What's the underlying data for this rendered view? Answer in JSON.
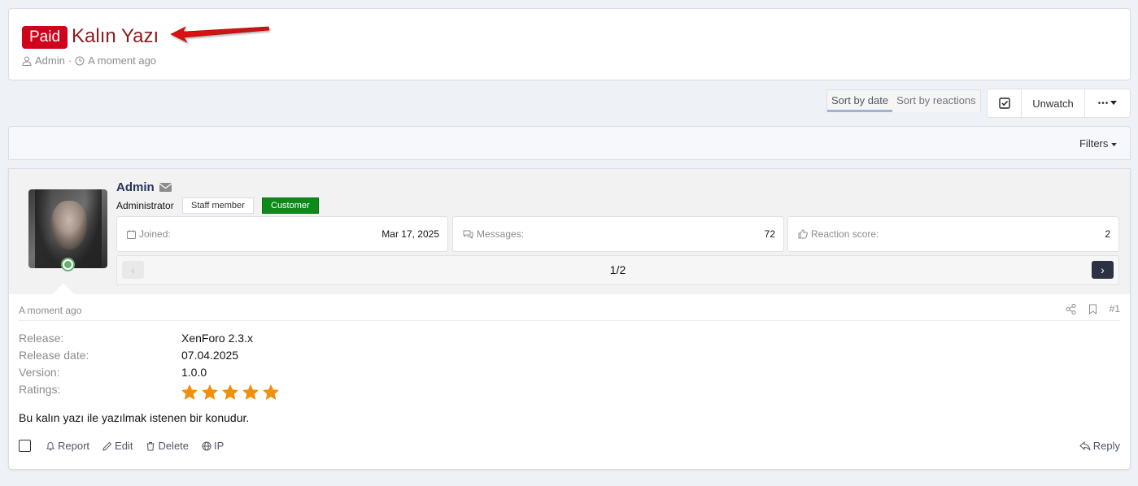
{
  "thread": {
    "badge": "Paid",
    "title": "Kalın Yazı",
    "author": "Admin",
    "time": "A moment ago",
    "meta_separator": "·"
  },
  "sort": {
    "options": [
      "Sort by date",
      "Sort by reactions"
    ],
    "active": "Sort by date"
  },
  "actions": {
    "unwatch": "Unwatch",
    "more": "•••"
  },
  "filters": {
    "label": "Filters"
  },
  "post": {
    "username": "Admin",
    "user_title": "Administrator",
    "badges": {
      "staff": "Staff member",
      "customer": "Customer"
    },
    "stats": {
      "joined_label": "Joined:",
      "joined_value": "Mar 17, 2025",
      "messages_label": "Messages:",
      "messages_value": "72",
      "reaction_label": "Reaction score:",
      "reaction_value": "2"
    },
    "pager": {
      "label": "1/2",
      "prev": "‹",
      "next": "›"
    },
    "time": "A moment ago",
    "number": "#1",
    "fields": [
      {
        "label": "Release:",
        "value": "XenForo 2.3.x"
      },
      {
        "label": "Release date:",
        "value": "07.04.2025"
      },
      {
        "label": "Version:",
        "value": "1.0.0"
      },
      {
        "label": "Ratings:",
        "value": ""
      }
    ],
    "rating": 5,
    "rating_max": 5,
    "body": "Bu kalın yazı ile yazılmak istenen bir konudur.",
    "actions": {
      "report": "Report",
      "edit": "Edit",
      "delete": "Delete",
      "ip": "IP",
      "reply": "Reply"
    }
  },
  "colors": {
    "paid_badge": "#d0021b",
    "title": "#8c1b1b",
    "star": "#f0900f",
    "customer_badge": "#0c8a1a",
    "online": "#63b06f"
  }
}
